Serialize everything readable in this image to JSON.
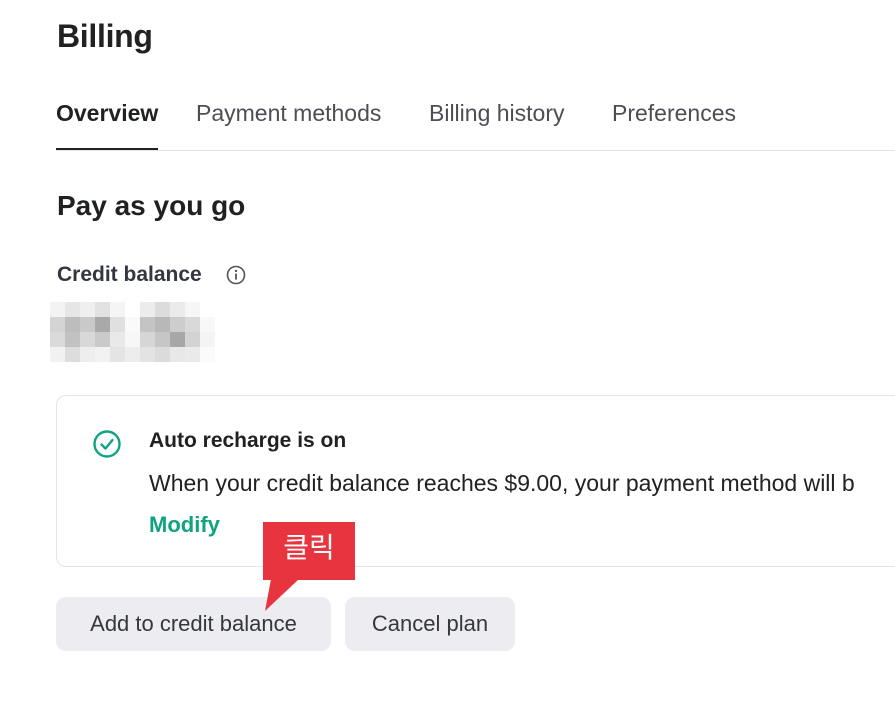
{
  "header": {
    "title": "Billing"
  },
  "tabs": [
    {
      "label": "Overview",
      "active": true
    },
    {
      "label": "Payment methods",
      "active": false
    },
    {
      "label": "Billing history",
      "active": false
    },
    {
      "label": "Preferences",
      "active": false
    }
  ],
  "main": {
    "section_title": "Pay as you go",
    "credit_label": "Credit balance",
    "info_icon": "info-icon",
    "credit_value_obscured": true,
    "auto_recharge": {
      "icon": "check-circle-icon",
      "title": "Auto recharge is on",
      "description": "When your credit balance reaches $9.00, your payment method will b",
      "modify_label": "Modify"
    },
    "buttons": {
      "add_label": "Add to credit balance",
      "cancel_label": "Cancel plan"
    }
  },
  "annotation": {
    "label": "클릭"
  },
  "colors": {
    "accent_green": "#10a37f",
    "callout_red": "#e8343e",
    "button_bg": "#ececf1",
    "text_primary": "#202123"
  }
}
